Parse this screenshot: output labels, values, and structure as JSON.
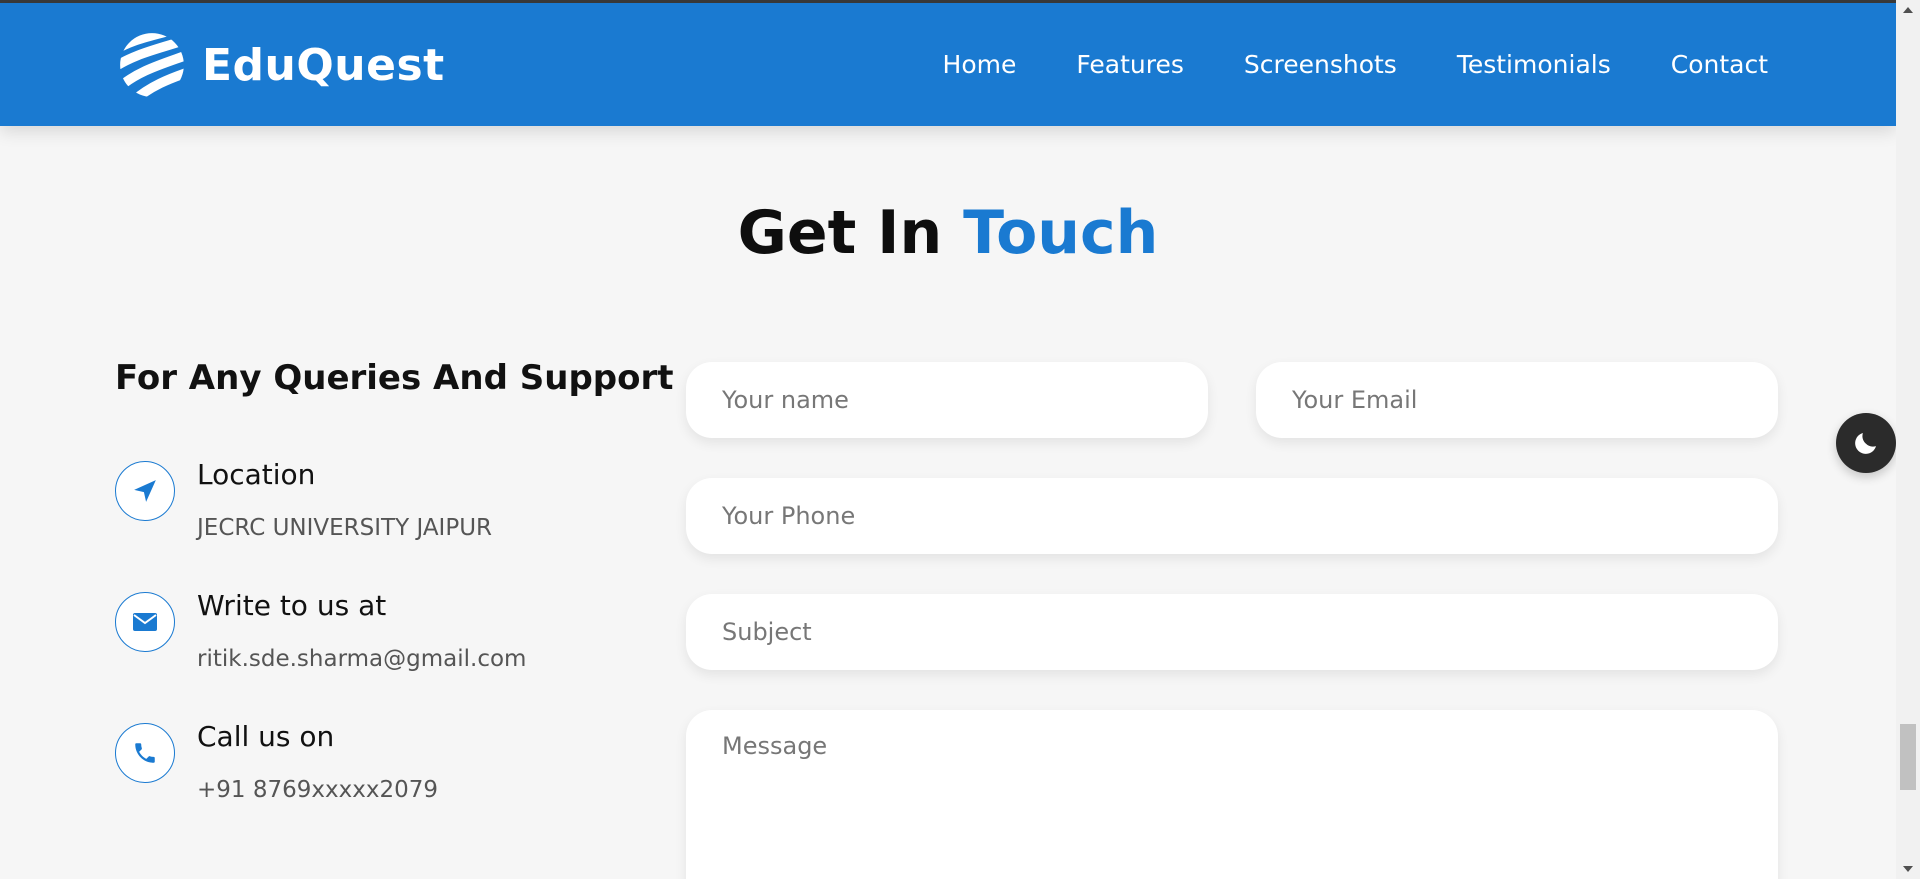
{
  "brand": {
    "name": "EduQuest",
    "logo_icon": "striped-globe-icon"
  },
  "nav": {
    "items": [
      {
        "label": "Home"
      },
      {
        "label": "Features"
      },
      {
        "label": "Screenshots"
      },
      {
        "label": "Testimonials"
      },
      {
        "label": "Contact"
      }
    ]
  },
  "section": {
    "title_main": "Get In ",
    "title_accent": "Touch"
  },
  "info": {
    "heading": "For Any Queries And Support",
    "items": [
      {
        "icon": "navigation-arrow-icon",
        "title": "Location",
        "value": "JECRC UNIVERSITY JAIPUR"
      },
      {
        "icon": "envelope-icon",
        "title": "Write to us at",
        "value": "ritik.sde.sharma@gmail.com"
      },
      {
        "icon": "phone-icon",
        "title": "Call us on",
        "value": "+91 8769xxxxx2079"
      }
    ]
  },
  "form": {
    "name_placeholder": "Your name",
    "email_placeholder": "Your Email",
    "phone_placeholder": "Your Phone",
    "subject_placeholder": "Subject",
    "message_placeholder": "Message",
    "name_value": "",
    "email_value": "",
    "phone_value": "",
    "subject_value": "",
    "message_value": ""
  },
  "theme_toggle": {
    "icon": "moon-icon"
  },
  "colors": {
    "primary": "#1a7ad1",
    "background": "#f6f6f6",
    "toggle": "#2b2b2b"
  }
}
